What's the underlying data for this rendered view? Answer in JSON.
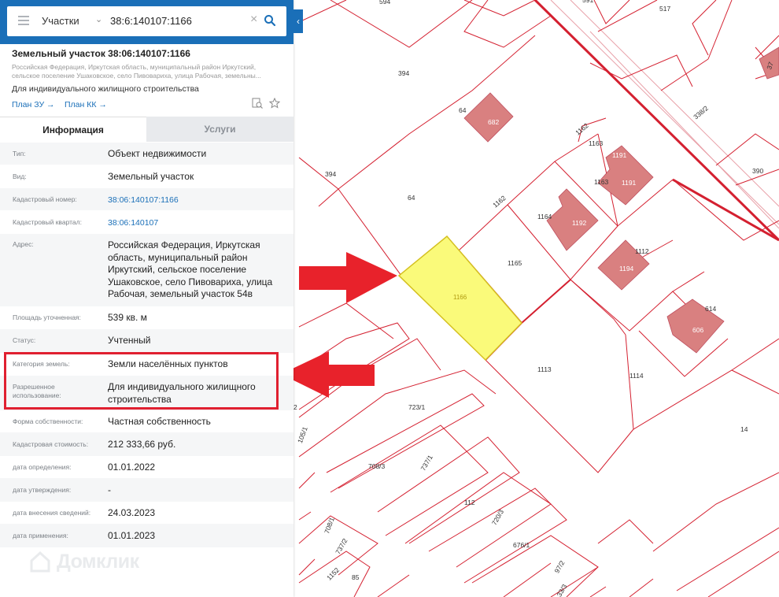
{
  "search": {
    "layer": "Участки",
    "query": "38:6:140107:1166"
  },
  "parcel": {
    "title": "Земельный участок 38:06:140107:1166",
    "address_short_1": "Российская Федерация, Иркутская область, муниципальный район Иркутский,",
    "address_short_2": "сельское поселение Ушаковское, село Пивовариха, улица Рабочая, земельны...",
    "use": "Для индивидуального жилищного строительства",
    "link_plan_zu": "План ЗУ →",
    "link_plan_kk": "План КК →"
  },
  "tabs": {
    "info": "Информация",
    "services": "Услуги"
  },
  "fields": [
    {
      "label": "Тип:",
      "value": "Объект недвижимости"
    },
    {
      "label": "Вид:",
      "value": "Земельный участок"
    },
    {
      "label": "Кадастровый номер:",
      "value": "38:06:140107:1166"
    },
    {
      "label": "Кадастровый квартал:",
      "value": "38:06:140107"
    },
    {
      "label": "Адрес:",
      "value_lines": [
        "Российская Федерация, Иркутская",
        "область, муниципальный район",
        "Иркутский, сельское поселение",
        "Ушаковское, село Пивовариха, улица",
        "Рабочая, земельный участок 54в"
      ]
    },
    {
      "label": "Площадь уточненная:",
      "value": "539 кв. м"
    },
    {
      "label": "Статус:",
      "value": "Учтенный"
    },
    {
      "label": "Категория земель:",
      "value": "Земли населённых пунктов"
    },
    {
      "label_lines": [
        "Разрешенное",
        "использование:"
      ],
      "value_lines": [
        "Для индивидуального жилищного",
        "строительства"
      ]
    },
    {
      "label": "Форма собственности:",
      "value": "Частная собственность"
    },
    {
      "label": "Кадастровая стоимость:",
      "value": "212 333,66 руб."
    },
    {
      "label": "дата определения:",
      "value": "01.01.2022"
    },
    {
      "label": "дата утверждения:",
      "value": "-"
    },
    {
      "label": "дата внесения сведений:",
      "value": "24.03.2023"
    },
    {
      "label": "дата применения:",
      "value": "01.01.2023"
    }
  ],
  "brand": "Домклик",
  "map_labels": [
    "594",
    "591",
    "517",
    "394",
    "64",
    "682",
    "1162",
    "1163",
    "1191",
    "1163",
    "1191",
    "338/2",
    "37",
    "390",
    "394",
    "64",
    "1162",
    "1164",
    "1192",
    "1165",
    "1112",
    "1194",
    "1166",
    "614",
    "606",
    "1113",
    "1114",
    "14",
    "723/1",
    "737/1",
    "708/3",
    "112",
    "720/3",
    "676/1",
    "708/1",
    "737/2",
    "1152",
    "85",
    "97/2",
    "33/3",
    "105/1",
    "2"
  ],
  "colors": {
    "accent": "#1a6fb8",
    "highlight": "#e02030",
    "selected_parcel": "#fafa7a",
    "building": "#d98080",
    "parcel_line": "#d42030"
  }
}
